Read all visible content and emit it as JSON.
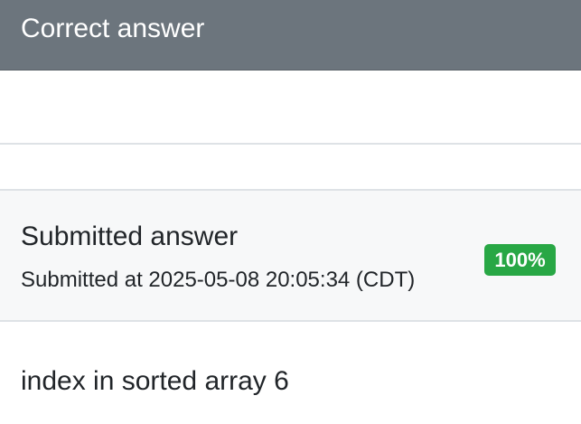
{
  "correct_answer": {
    "header_title": "Correct answer"
  },
  "submission": {
    "title": "Submitted answer",
    "submitted_at": "Submitted at 2025-05-08 20:05:34 (CDT)",
    "score_badge": "100%",
    "answer_text": "index in sorted array 6"
  },
  "colors": {
    "header_bg": "#6c757d",
    "badge_success": "#28a745",
    "submission_header_bg": "#f7f8f9"
  }
}
